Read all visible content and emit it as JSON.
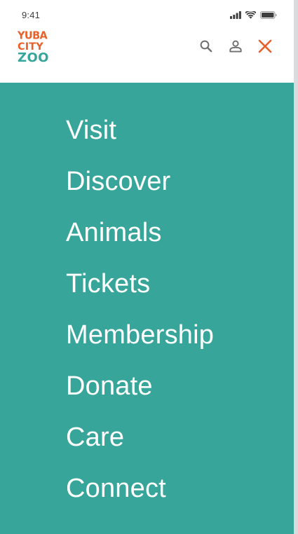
{
  "status_bar": {
    "time": "9:41",
    "icons": [
      "cellular-signal-icon",
      "wifi-icon",
      "battery-icon"
    ]
  },
  "header": {
    "logo": {
      "line1": "YUBA",
      "line2": "CITY",
      "line3": "ZOO"
    },
    "actions": [
      "search-icon",
      "account-icon",
      "close-icon"
    ]
  },
  "menu": {
    "items": [
      {
        "label": "Visit"
      },
      {
        "label": "Discover"
      },
      {
        "label": "Animals"
      },
      {
        "label": "Tickets"
      },
      {
        "label": "Membership"
      },
      {
        "label": "Donate"
      },
      {
        "label": "Care"
      },
      {
        "label": "Connect"
      }
    ]
  },
  "colors": {
    "accent_orange": "#e8602a",
    "teal": "#37a59a",
    "logo_teal": "#36a59a",
    "icon_gray": "#6e6e6e",
    "text_white": "#ffffff"
  }
}
